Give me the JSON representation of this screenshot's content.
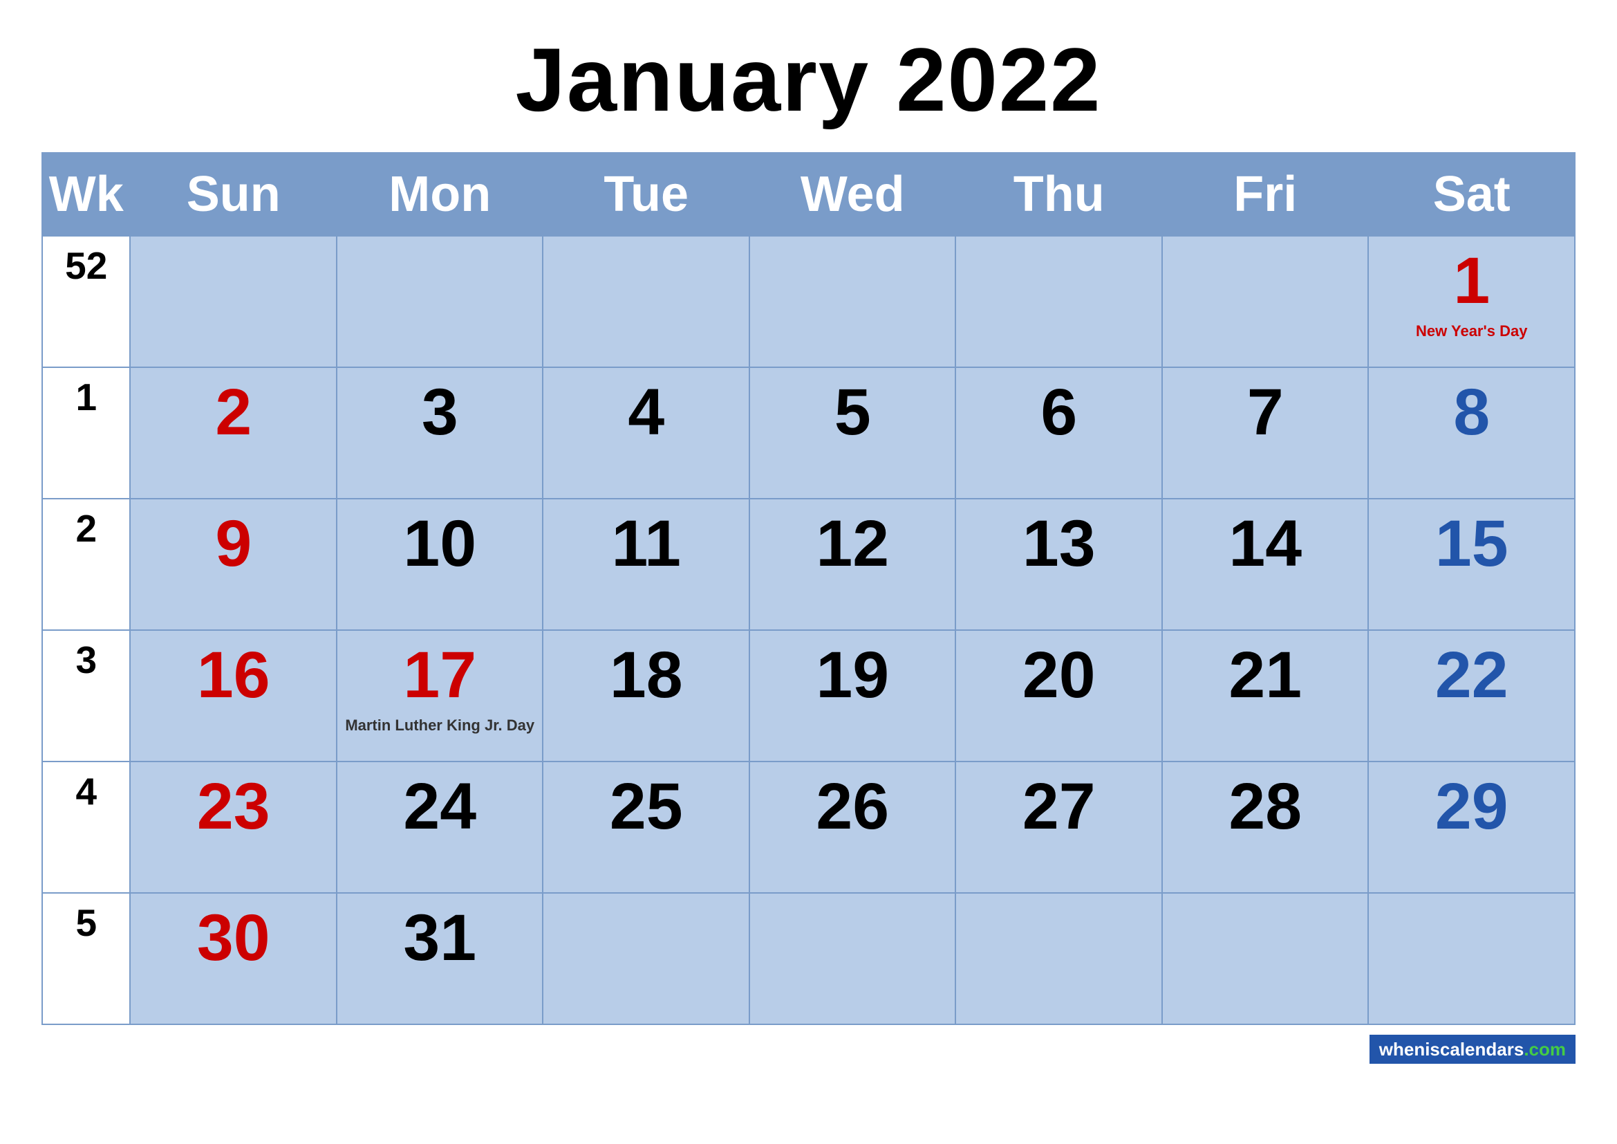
{
  "title": "January 2022",
  "header": {
    "wk": "Wk",
    "days": [
      "Sun",
      "Mon",
      "Tue",
      "Wed",
      "Thu",
      "Fri",
      "Sat"
    ]
  },
  "weeks": [
    {
      "wk": "52",
      "days": [
        {
          "num": "",
          "type": "empty"
        },
        {
          "num": "",
          "type": "empty"
        },
        {
          "num": "",
          "type": "empty"
        },
        {
          "num": "",
          "type": "empty"
        },
        {
          "num": "",
          "type": "empty"
        },
        {
          "num": "",
          "type": "empty"
        },
        {
          "num": "1",
          "type": "holiday-num",
          "holiday": "New Year's Day"
        }
      ]
    },
    {
      "wk": "1",
      "days": [
        {
          "num": "2",
          "type": "sunday"
        },
        {
          "num": "3",
          "type": "normal"
        },
        {
          "num": "4",
          "type": "normal"
        },
        {
          "num": "5",
          "type": "normal"
        },
        {
          "num": "6",
          "type": "normal"
        },
        {
          "num": "7",
          "type": "normal"
        },
        {
          "num": "8",
          "type": "saturday"
        }
      ]
    },
    {
      "wk": "2",
      "days": [
        {
          "num": "9",
          "type": "sunday"
        },
        {
          "num": "10",
          "type": "normal"
        },
        {
          "num": "11",
          "type": "normal"
        },
        {
          "num": "12",
          "type": "normal"
        },
        {
          "num": "13",
          "type": "normal"
        },
        {
          "num": "14",
          "type": "normal"
        },
        {
          "num": "15",
          "type": "saturday"
        }
      ]
    },
    {
      "wk": "3",
      "days": [
        {
          "num": "16",
          "type": "sunday"
        },
        {
          "num": "17",
          "type": "mlk",
          "holiday": "Martin Luther King Jr. Day"
        },
        {
          "num": "18",
          "type": "normal"
        },
        {
          "num": "19",
          "type": "normal"
        },
        {
          "num": "20",
          "type": "normal"
        },
        {
          "num": "21",
          "type": "normal"
        },
        {
          "num": "22",
          "type": "saturday"
        }
      ]
    },
    {
      "wk": "4",
      "days": [
        {
          "num": "23",
          "type": "sunday"
        },
        {
          "num": "24",
          "type": "normal"
        },
        {
          "num": "25",
          "type": "normal"
        },
        {
          "num": "26",
          "type": "normal"
        },
        {
          "num": "27",
          "type": "normal"
        },
        {
          "num": "28",
          "type": "normal"
        },
        {
          "num": "29",
          "type": "saturday"
        }
      ]
    },
    {
      "wk": "5",
      "days": [
        {
          "num": "30",
          "type": "sunday"
        },
        {
          "num": "31",
          "type": "normal"
        },
        {
          "num": "",
          "type": "empty"
        },
        {
          "num": "",
          "type": "empty"
        },
        {
          "num": "",
          "type": "empty"
        },
        {
          "num": "",
          "type": "empty"
        },
        {
          "num": "",
          "type": "empty"
        }
      ]
    }
  ],
  "footer": {
    "site_text": "wheniscalendars",
    "site_tld": ".com"
  }
}
